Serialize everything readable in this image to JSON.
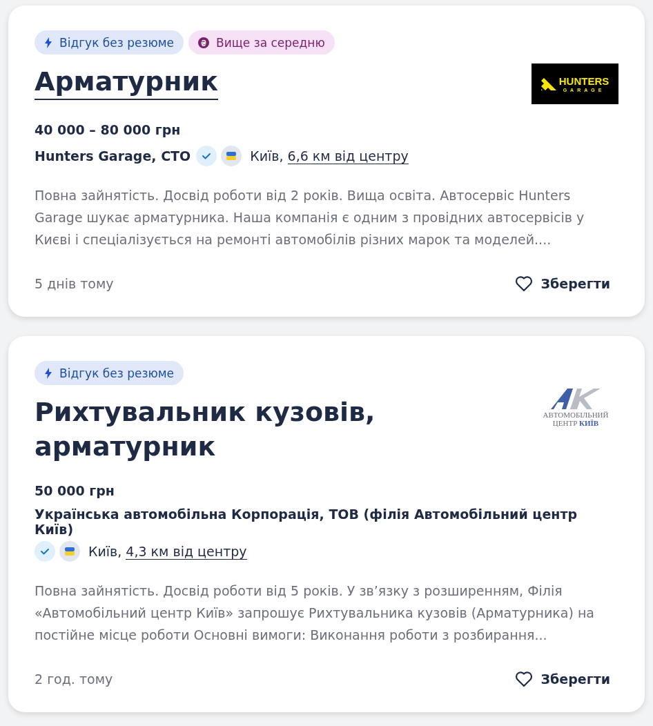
{
  "vacancies": [
    {
      "tags": [
        {
          "kind": "no_resume",
          "label": "Відгук без резюме"
        },
        {
          "kind": "above_average",
          "label": "Вище за середню"
        }
      ],
      "title": "Арматурник",
      "title_underlined": true,
      "logo": {
        "kind": "hunters",
        "lines": [
          "HUNTERS",
          "GARAGE"
        ]
      },
      "salary": "40 000 – 80 000 грн",
      "company": "Hunters Garage, СТО",
      "verified": true,
      "ukrainian": true,
      "city": "Київ,",
      "distance": "6,6 км від центру",
      "description": "Повна зайнятість. Досвід роботи від 2 років. Вища освіта. Автосервіс Hunters Garage шукає арматурника. Наша компанія є одним з провідних автосервісів у Києві і спеціалізується на ремонті автомобілів різних марок та моделей....",
      "posted": "5 днів тому",
      "save": "Зберегти"
    },
    {
      "tags": [
        {
          "kind": "no_resume",
          "label": "Відгук без резюме"
        }
      ],
      "title": "Рихтувальник кузовів, арматурник",
      "title_underlined": false,
      "logo": {
        "kind": "avtocentr",
        "lines": [
          "АВТОМОБІЛЬНИЙ",
          "ЦЕНТР **КИЇВ**"
        ]
      },
      "salary": "50 000 грн",
      "company": "Українська автомобільна Корпорація, ТОВ (філія Автомобільний центр Київ)",
      "verified": true,
      "ukrainian": true,
      "city": "Київ,",
      "distance": "4,3 км від центру",
      "description": "Повна зайнятість. Досвід роботи від 5 років. У зв’язку з розширенням, Філія «Автомобільний центр Київ» запрошує Рихтувальника кузовів (Арматурника) на постійне місце роботи Основні вимоги: Виконання роботи з розбирання...",
      "posted": "2 год. тому",
      "save": "Зберегти"
    }
  ]
}
